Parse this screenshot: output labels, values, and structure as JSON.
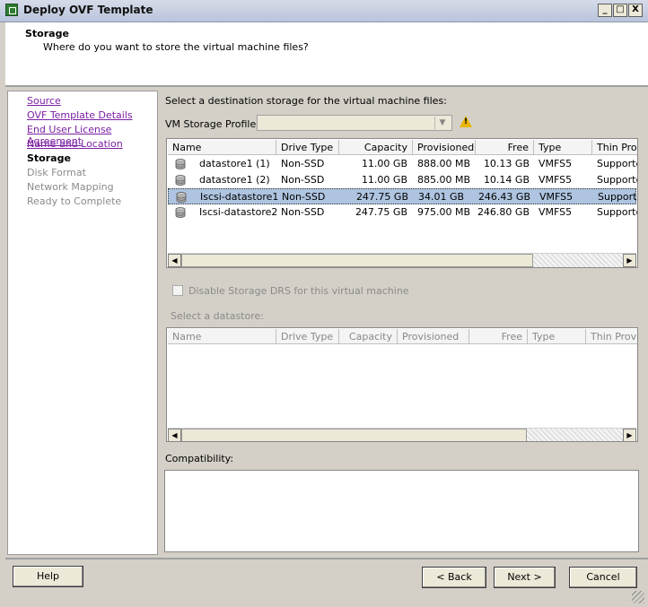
{
  "window": {
    "title": "Deploy OVF Template",
    "minimize": "_",
    "maximize": "□",
    "close": "X"
  },
  "header": {
    "title": "Storage",
    "subtitle": "Where do you want to store the virtual machine files?"
  },
  "nav": {
    "items": [
      {
        "label": "Source",
        "state": "link"
      },
      {
        "label": "OVF Template Details",
        "state": "link"
      },
      {
        "label": "End User License Agreement",
        "state": "link"
      },
      {
        "label": "Name and Location",
        "state": "link"
      },
      {
        "label": "Storage",
        "state": "current"
      },
      {
        "label": "Disk Format",
        "state": "disabled"
      },
      {
        "label": "Network Mapping",
        "state": "disabled"
      },
      {
        "label": "Ready to Complete",
        "state": "disabled"
      }
    ]
  },
  "main": {
    "instruction": "Select a destination storage for the virtual machine files:",
    "profile_label": "VM Storage Profile:",
    "profile_value": "",
    "columns": [
      "Name",
      "Drive Type",
      "Capacity",
      "Provisioned",
      "Free",
      "Type",
      "Thin Prov"
    ],
    "rows": [
      {
        "name": "datastore1 (1)",
        "drive": "Non-SSD",
        "capacity": "11.00 GB",
        "provisioned": "888.00 MB",
        "free": "10.13 GB",
        "type": "VMFS5",
        "thin": "Supported",
        "selected": false
      },
      {
        "name": "datastore1 (2)",
        "drive": "Non-SSD",
        "capacity": "11.00 GB",
        "provisioned": "885.00 MB",
        "free": "10.14 GB",
        "type": "VMFS5",
        "thin": "Supported",
        "selected": false
      },
      {
        "name": "Iscsi-datastore1",
        "drive": "Non-SSD",
        "capacity": "247.75 GB",
        "provisioned": "34.01 GB",
        "free": "246.43 GB",
        "type": "VMFS5",
        "thin": "Supported",
        "selected": true
      },
      {
        "name": "Iscsi-datastore2",
        "drive": "Non-SSD",
        "capacity": "247.75 GB",
        "provisioned": "975.00 MB",
        "free": "246.80 GB",
        "type": "VMFS5",
        "thin": "Supported",
        "selected": false
      }
    ],
    "drs_label": "Disable Storage DRS for this virtual machine",
    "select_datastore_label": "Select a datastore:",
    "columns2": [
      "Name",
      "Drive Type",
      "Capacity",
      "Provisioned",
      "Free",
      "Type",
      "Thin Provi"
    ],
    "compat_label": "Compatibility:"
  },
  "footer": {
    "help": "Help",
    "back": "< Back",
    "next": "Next >",
    "cancel": "Cancel"
  },
  "icons": {
    "app": "vsphere-app-icon",
    "warning": "warning-icon",
    "datastore": "datastore-icon"
  }
}
